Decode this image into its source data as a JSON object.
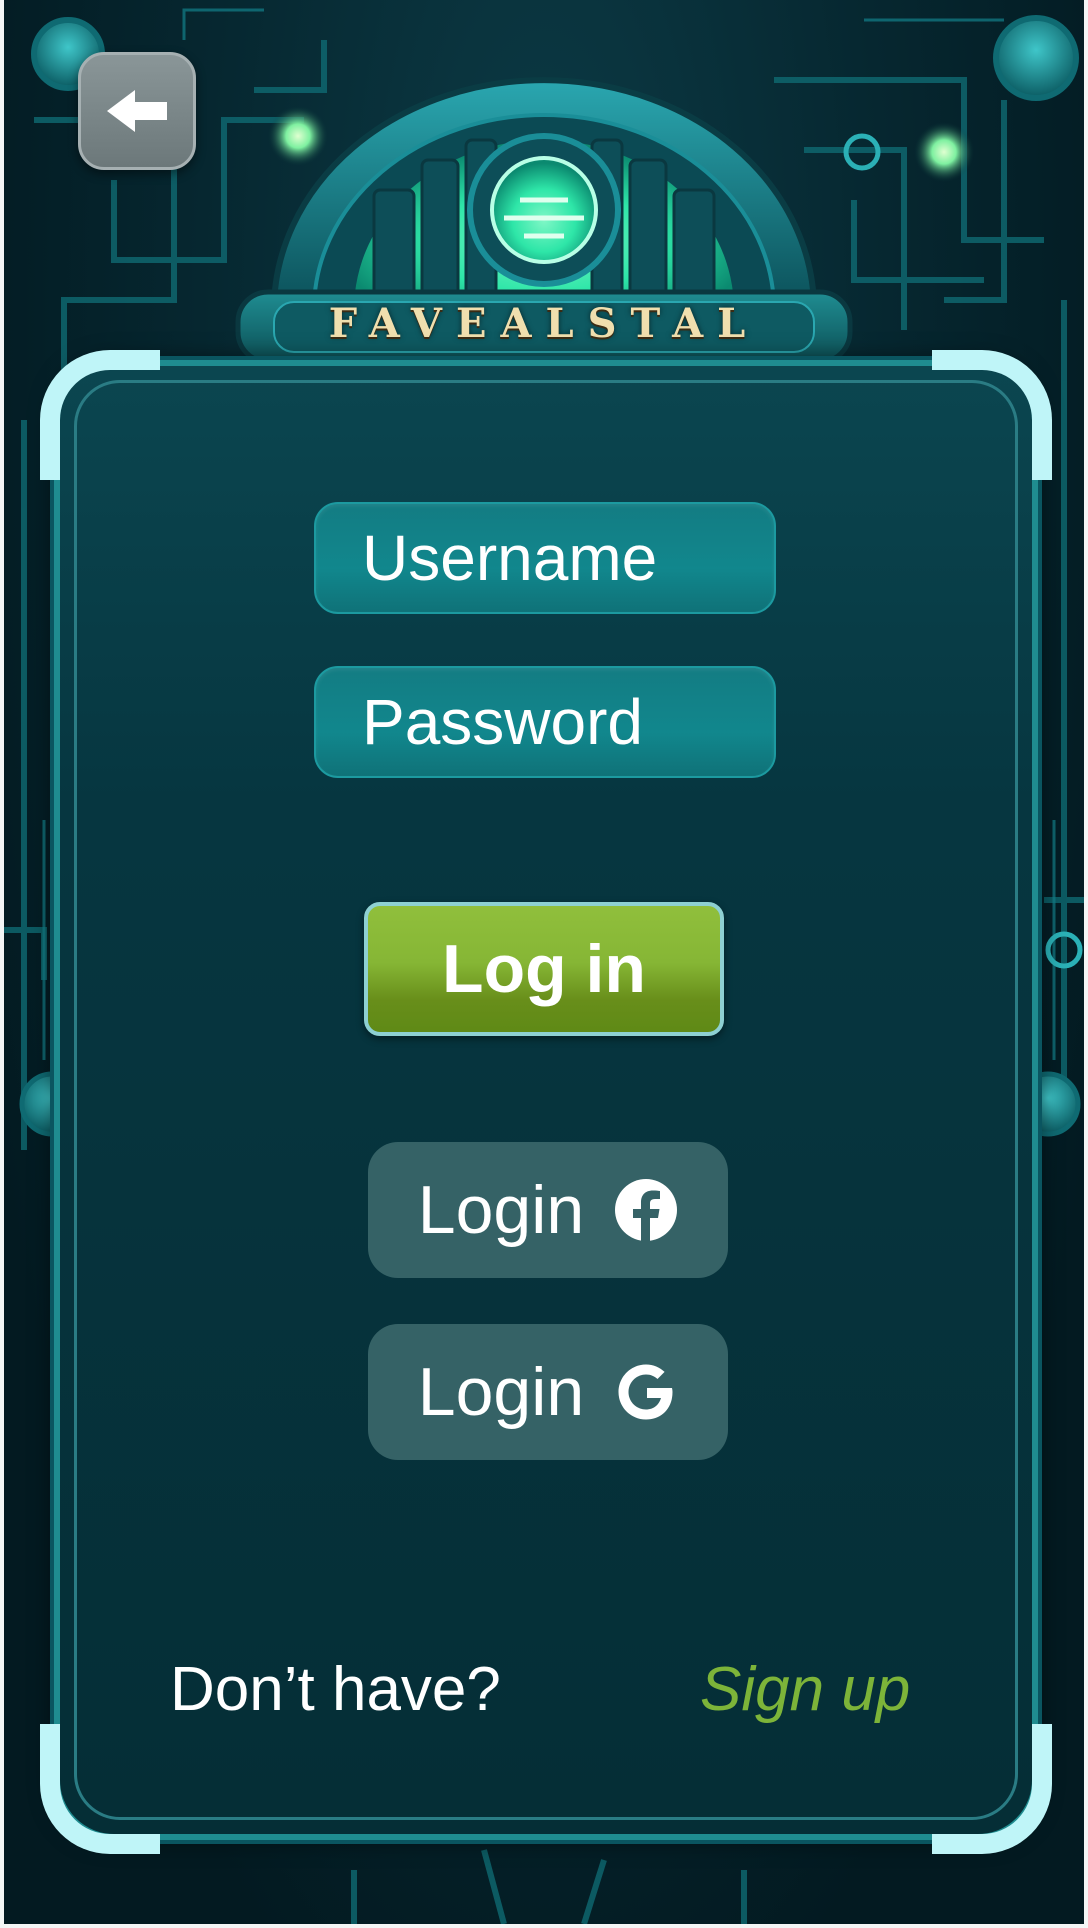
{
  "header": {
    "back_icon": "arrow-left-icon",
    "emblem_title": "FAVEALSTAL"
  },
  "form": {
    "username_placeholder": "Username",
    "password_placeholder": "Password",
    "login_label": "Log in"
  },
  "social": {
    "facebook_label": "Login",
    "facebook_icon": "facebook-icon",
    "google_label": "Login",
    "google_icon": "google-icon"
  },
  "footer": {
    "prompt": "Don’t have?",
    "signup_label": "Sign up"
  },
  "colors": {
    "accent_green": "#7db439",
    "button_green": "#86b635",
    "panel_teal": "#063640",
    "field_teal": "#11878d",
    "corner_glow": "#bff5f8",
    "emblem_glow": "#2ee6a8"
  }
}
